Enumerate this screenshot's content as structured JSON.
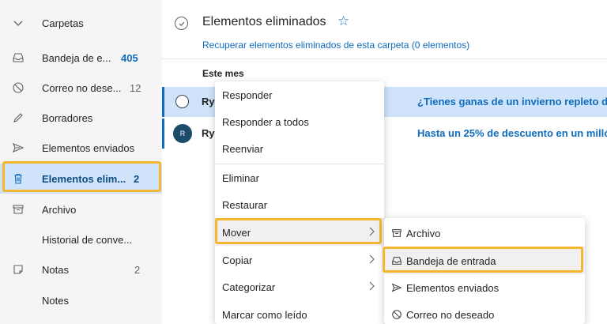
{
  "sidebar": {
    "header_label": "Carpetas",
    "items": [
      {
        "label": "Bandeja de e...",
        "count": "405",
        "icon": "inbox-icon"
      },
      {
        "label": "Correo no dese...",
        "count": "12",
        "icon": "blocked-icon"
      },
      {
        "label": "Borradores",
        "count": "",
        "icon": "pencil-icon"
      },
      {
        "label": "Elementos enviados",
        "count": "",
        "icon": "send-icon"
      },
      {
        "label": "Elementos elim...",
        "count": "2",
        "icon": "trash-icon"
      },
      {
        "label": "Archivo",
        "count": "",
        "icon": "archive-icon"
      },
      {
        "label": "Historial de conve...",
        "count": "",
        "icon": ""
      },
      {
        "label": "Notas",
        "count": "2",
        "icon": "note-icon"
      },
      {
        "label": "Notes",
        "count": "",
        "icon": ""
      }
    ]
  },
  "main": {
    "title": "Elementos eliminados",
    "recover_link": "Recuperar elementos eliminados de esta carpeta (0 elementos)",
    "group_header": "Este mes",
    "messages": [
      {
        "sender": "Rya",
        "subject": "¿Tienes ganas de un invierno repleto de"
      },
      {
        "sender": "Rya",
        "avatar": "R",
        "subject": "Hasta un 25% de descuento en un milló"
      }
    ]
  },
  "context_menu": {
    "items": [
      "Responder",
      "Responder a todos",
      "Reenviar",
      "Eliminar",
      "Restaurar",
      "Mover",
      "Copiar",
      "Categorizar",
      "Marcar como leído"
    ]
  },
  "move_submenu": {
    "items": [
      {
        "label": "Archivo",
        "icon": "archive-icon"
      },
      {
        "label": "Bandeja de entrada",
        "icon": "inbox-icon"
      },
      {
        "label": "Elementos enviados",
        "icon": "send-icon"
      },
      {
        "label": "Correo no deseado",
        "icon": "blocked-icon"
      }
    ]
  },
  "colors": {
    "accent": "#0f6cbd",
    "selection": "#cfe4fa",
    "highlight": "#f5b731"
  }
}
